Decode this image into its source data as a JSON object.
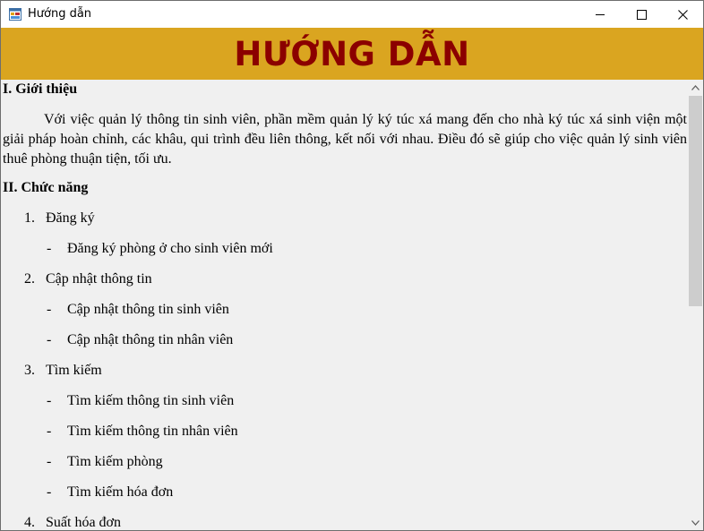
{
  "window": {
    "title": "Hướng dẫn",
    "icons": {
      "app": "app-form-icon",
      "minimize": "minimize-icon",
      "maximize": "maximize-icon",
      "close": "close-icon"
    }
  },
  "banner": {
    "title": "HƯỚNG DẪN"
  },
  "colors": {
    "banner_bg": "#daa520",
    "banner_text": "#8b0000"
  },
  "content": {
    "intro_heading": "I. Giới thiệu",
    "intro_text": "Với việc quản lý thông tin sinh viên, phần mềm quản lý ký túc xá mang đến cho nhà ký túc xá sinh viện một giải pháp hoàn chỉnh, các khâu, qui trình đều liên thông, kết nối với nhau. Điều đó sẽ giúp cho việc quản lý sinh viên thuê phòng thuận tiện, tối ưu.",
    "features_heading": "II. Chức năng",
    "features": [
      {
        "number": "1.",
        "title": "Đăng ký",
        "items": [
          "Đăng ký phòng ở cho sinh viên mới"
        ]
      },
      {
        "number": "2.",
        "title": "Cập nhật thông tin",
        "items": [
          "Cập nhật thông tin sinh viên",
          "Cập nhật thông tin nhân viên"
        ]
      },
      {
        "number": "3.",
        "title": "Tìm kiếm",
        "items": [
          "Tìm kiếm thông tin sinh viên",
          "Tìm kiếm thông tin nhân viên",
          "Tìm kiếm phòng",
          "Tìm kiếm hóa đơn"
        ]
      },
      {
        "number": "4.",
        "title": "Suất hóa đơn",
        "items": []
      }
    ],
    "dash": "-"
  },
  "scrollbar": {
    "up": "scroll-up-arrow-icon",
    "down": "scroll-down-arrow-icon"
  }
}
